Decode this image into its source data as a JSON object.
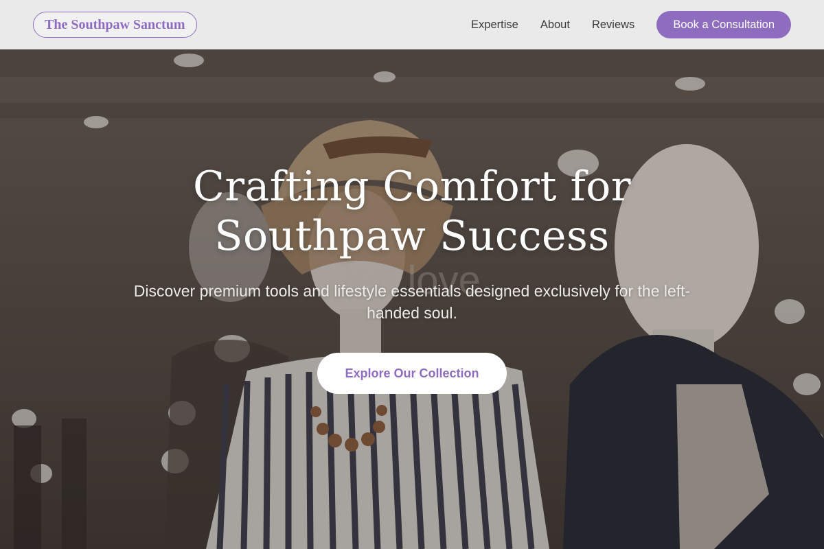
{
  "brand": {
    "name": "The Southpaw Sanctum"
  },
  "nav": {
    "items": [
      {
        "label": "Expertise"
      },
      {
        "label": "About"
      },
      {
        "label": "Reviews"
      }
    ],
    "cta_label": "Book a Consultation"
  },
  "hero": {
    "title_line1": "Crafting Comfort for",
    "title_line2": "Southpaw Success",
    "subtitle": "Discover premium tools and lifestyle essentials designed exclusively for the left-handed soul.",
    "button_label": "Explore Our Collection",
    "background_caption": "left love"
  },
  "colors": {
    "accent": "#8e6cc0",
    "header_bg": "#f0f0f0",
    "button_bg": "#ffffff",
    "text_on_hero": "#ffffff"
  }
}
